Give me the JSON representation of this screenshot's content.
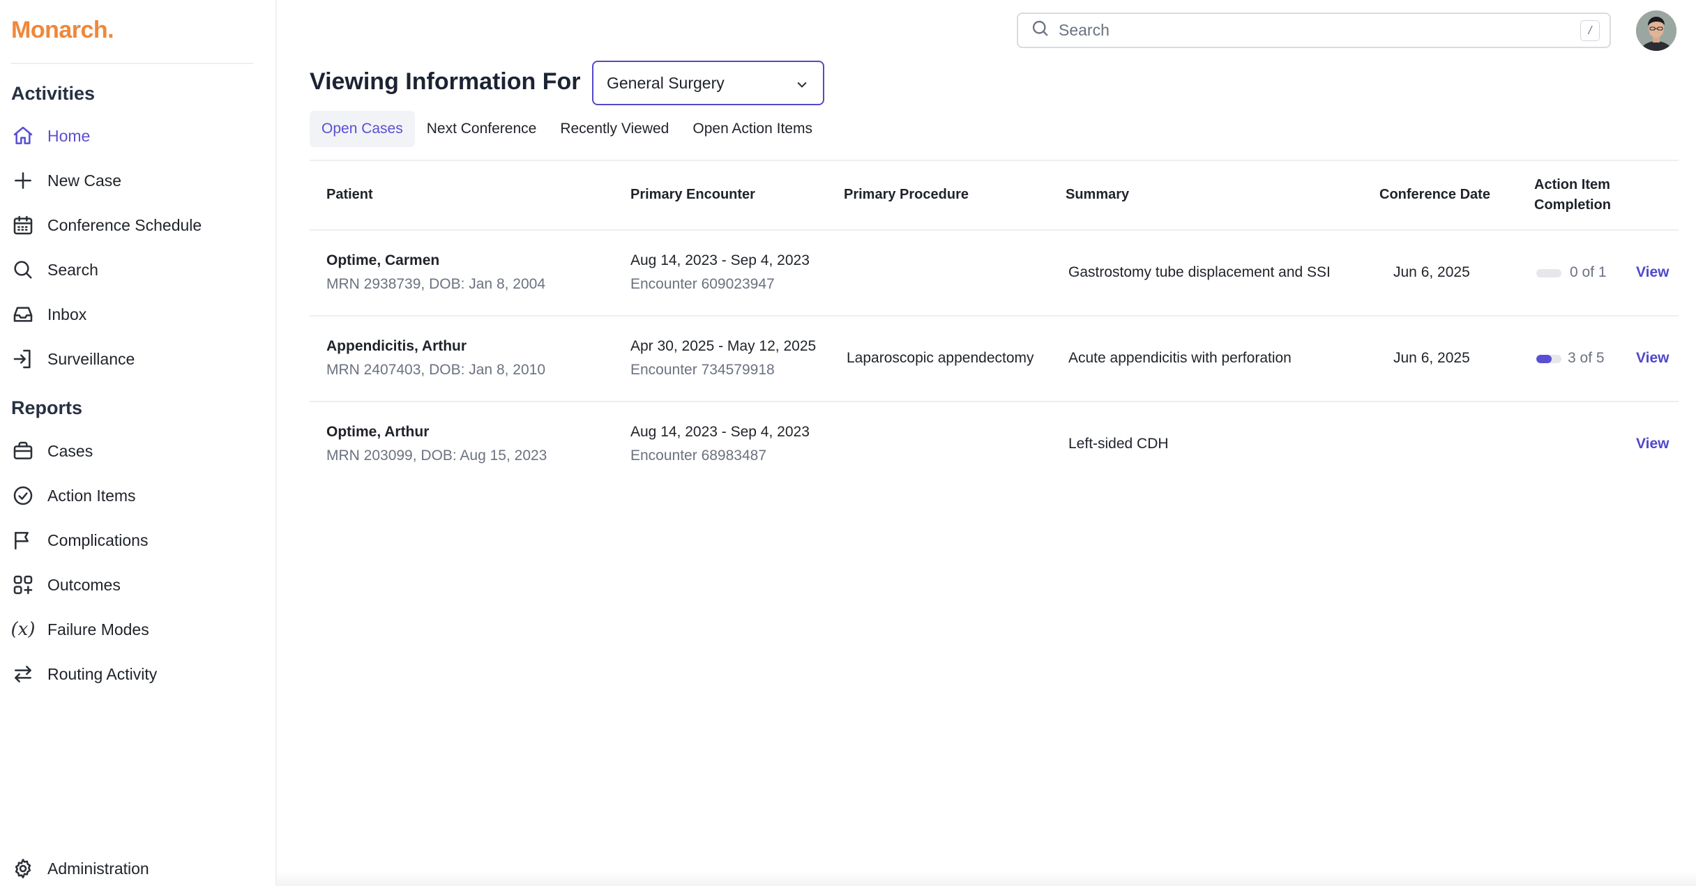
{
  "app": {
    "logo": "Monarch."
  },
  "sidebar": {
    "activities_title": "Activities",
    "activities": [
      {
        "label": "Home",
        "icon": "home-icon",
        "active": true
      },
      {
        "label": "New Case",
        "icon": "plus-icon"
      },
      {
        "label": "Conference Schedule",
        "icon": "calendar-icon"
      },
      {
        "label": "Search",
        "icon": "search-icon"
      },
      {
        "label": "Inbox",
        "icon": "inbox-icon"
      },
      {
        "label": "Surveillance",
        "icon": "login-icon"
      }
    ],
    "reports_title": "Reports",
    "reports": [
      {
        "label": "Cases",
        "icon": "briefcase-icon"
      },
      {
        "label": "Action Items",
        "icon": "check-circle-icon"
      },
      {
        "label": "Complications",
        "icon": "flag-icon"
      },
      {
        "label": "Outcomes",
        "icon": "squares-plus-icon"
      },
      {
        "label": "Failure Modes",
        "icon": "function-icon"
      },
      {
        "label": "Routing Activity",
        "icon": "arrows-exchange-icon"
      }
    ],
    "admin": {
      "label": "Administration",
      "icon": "gear-icon"
    }
  },
  "topbar": {
    "search_placeholder": "Search",
    "search_shortcut": "/"
  },
  "header": {
    "title": "Viewing Information For",
    "department": "General Surgery"
  },
  "tabs": [
    {
      "label": "Open Cases",
      "active": true
    },
    {
      "label": "Next Conference"
    },
    {
      "label": "Recently Viewed"
    },
    {
      "label": "Open Action Items"
    }
  ],
  "table": {
    "columns": {
      "patient": "Patient",
      "encounter": "Primary Encounter",
      "procedure": "Primary Procedure",
      "summary": "Summary",
      "conference": "Conference Date",
      "completion_line1": "Action Item",
      "completion_line2": "Completion"
    },
    "rows": [
      {
        "patient": "Optime, Carmen",
        "patient_meta": "MRN 2938739, DOB: Jan 8, 2004",
        "encounter_dates": "Aug 14, 2023 - Sep 4, 2023",
        "encounter_id": "Encounter 609023947",
        "procedure": "",
        "summary": "Gastrostomy tube displacement and SSI",
        "conference_date": "Jun 6, 2025",
        "completion": "0 of 1",
        "completion_fraction": 0,
        "action": "View"
      },
      {
        "patient": "Appendicitis, Arthur",
        "patient_meta": "MRN 2407403, DOB: Jan 8, 2010",
        "encounter_dates": "Apr 30, 2025 - May 12, 2025",
        "encounter_id": "Encounter 734579918",
        "procedure": "Laparoscopic appendectomy",
        "summary": "Acute appendicitis with perforation",
        "conference_date": "Jun 6, 2025",
        "completion": "3 of 5",
        "completion_fraction": 0.6,
        "action": "View"
      },
      {
        "patient": "Optime, Arthur",
        "patient_meta": "MRN 203099, DOB: Aug 15, 2023",
        "encounter_dates": "Aug 14, 2023 - Sep 4, 2023",
        "encounter_id": "Encounter 68983487",
        "procedure": "",
        "summary": "Left-sided CDH",
        "conference_date": "",
        "completion": "",
        "action": "View"
      }
    ]
  },
  "colors": {
    "brand": "#f0873a",
    "accent": "#5a4fd4"
  }
}
